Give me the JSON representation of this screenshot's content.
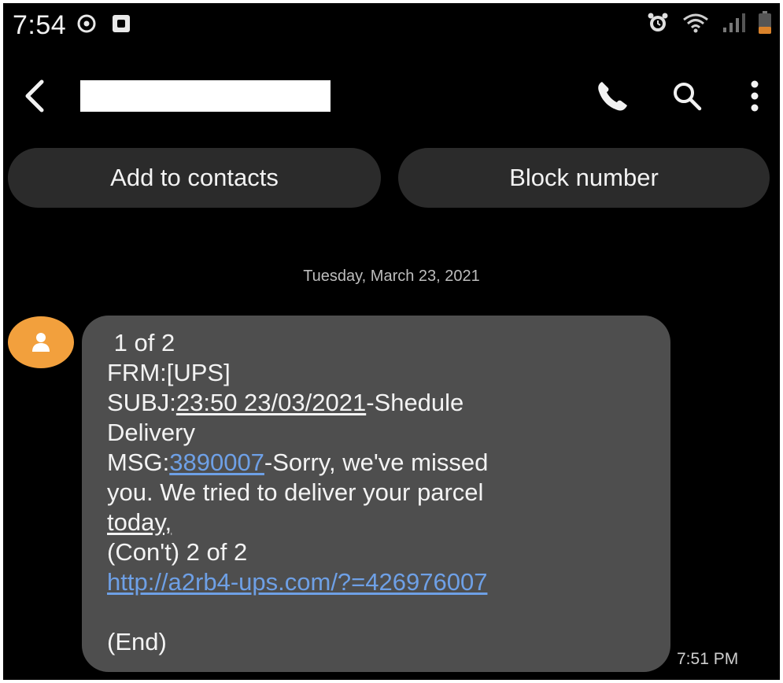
{
  "status_bar": {
    "time": "7:54",
    "left_icons": [
      "sync-icon",
      "notification-square-icon"
    ],
    "right_icons": [
      "alarm-icon",
      "wifi-icon",
      "signal-icon",
      "battery-low-icon"
    ]
  },
  "header": {
    "contact_name": "",
    "icons": [
      "back-icon",
      "phone-icon",
      "search-icon",
      "more-vertical-icon"
    ]
  },
  "actions": {
    "add_to_contacts": "Add to contacts",
    "block_number": "Block number"
  },
  "conversation": {
    "date": "Tuesday, March 23, 2021",
    "message": {
      "line1": "1 of 2",
      "line2": "FRM:[UPS]",
      "line3_prefix": "SUBJ:",
      "line3_underlined": "23:50 23/03/2021",
      "line3_suffix": "-Shedule",
      "line4": "Delivery",
      "line5_prefix": "MSG:",
      "line5_link": "3890007",
      "line5_suffix": "-Sorry, we've missed",
      "line6": "you. We tried to deliver your parcel",
      "line7_underlined": "today,",
      "line8": "(Con't) 2 of 2",
      "line9_link": "http://a2rb4-ups.com/?=426976007",
      "line10": "(End)"
    },
    "timestamp": "7:51 PM"
  },
  "colors": {
    "background": "#000000",
    "bubble": "#4e4e4e",
    "pill": "#2b2b2b",
    "avatar": "#f2a03d",
    "link": "#6ea0e6",
    "battery": "#d9822b"
  }
}
